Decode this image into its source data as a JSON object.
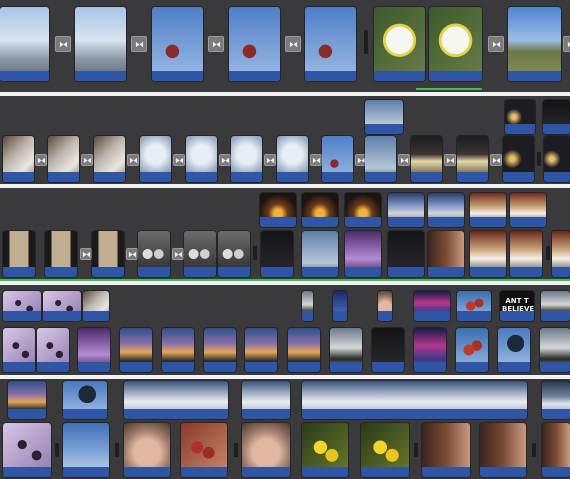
{
  "app": {
    "window_title": "",
    "layout": "timeline-strips"
  },
  "strips": [
    {
      "name": "strip-1",
      "clips": [
        {
          "kind": "clip",
          "theme": "sky1",
          "label": ""
        },
        {
          "kind": "transition",
          "icon": "cross-dissolve-icon"
        },
        {
          "kind": "clip",
          "theme": "sky1",
          "label": ""
        },
        {
          "kind": "transition",
          "icon": "cross-dissolve-icon"
        },
        {
          "kind": "clip",
          "theme": "branch",
          "label": ""
        },
        {
          "kind": "transition",
          "icon": "cross-dissolve-icon"
        },
        {
          "kind": "clip",
          "theme": "branch",
          "label": ""
        },
        {
          "kind": "transition",
          "icon": "cross-dissolve-icon"
        },
        {
          "kind": "clip",
          "theme": "branch",
          "label": ""
        },
        {
          "kind": "clip",
          "theme": "flower",
          "label": ""
        },
        {
          "kind": "clip",
          "theme": "flower",
          "label": ""
        },
        {
          "kind": "transition",
          "icon": "cross-dissolve-icon"
        },
        {
          "kind": "clip",
          "theme": "field",
          "label": ""
        }
      ]
    }
  ],
  "icons": {
    "transition": "cross-dissolve-icon",
    "trim_handle": "trim-handle-icon"
  },
  "colors": {
    "background": "#3f3f41",
    "audio_track": "#2f56a6",
    "selection": "#3bbf53",
    "separator": "#f2f2f2"
  },
  "overlays": {
    "believe_text": "ANT T\nBELIEVE"
  }
}
